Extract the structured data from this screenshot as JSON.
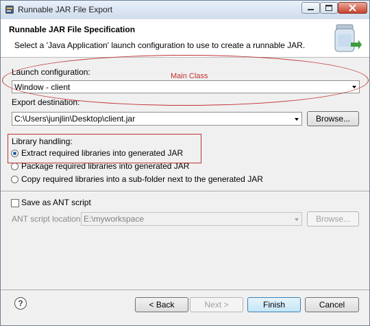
{
  "window": {
    "title": "Runnable JAR File Export"
  },
  "header": {
    "title": "Runnable JAR File Specification",
    "description": "Select a 'Java Application' launch configuration to use to create a runnable JAR."
  },
  "launch": {
    "label": "Launch configuration:",
    "value": "Window - client"
  },
  "export": {
    "label": "Export destination:",
    "value": "C:\\Users\\junjlin\\Desktop\\client.jar",
    "browse": "Browse..."
  },
  "library": {
    "label": "Library handling:",
    "options": [
      {
        "label": "Extract required libraries into generated JAR",
        "selected": true
      },
      {
        "label": "Package required libraries into generated JAR",
        "selected": false
      },
      {
        "label": "Copy required libraries into a sub-folder next to the generated JAR",
        "selected": false
      }
    ]
  },
  "ant": {
    "checkbox_label": "Save as ANT script",
    "checked": false,
    "location_label": "ANT script location:",
    "location_value": "E:\\myworkspace",
    "browse": "Browse..."
  },
  "footer": {
    "back": "< Back",
    "next": "Next >",
    "finish": "Finish",
    "cancel": "Cancel",
    "help": "?"
  },
  "annotation": {
    "text": "Main Class",
    "color": "#c03030"
  },
  "colors": {
    "accent": "#3c7fb1",
    "header_bg": "#ffffff",
    "dialog_bg": "#f0f0f0"
  }
}
